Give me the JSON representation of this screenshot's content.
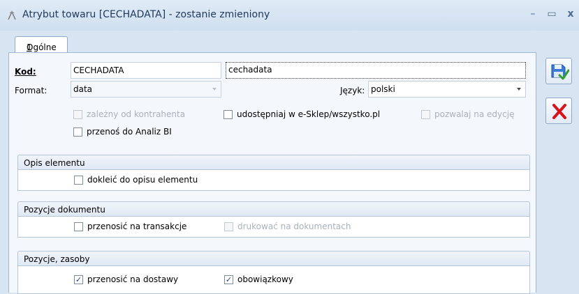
{
  "window": {
    "title": "Atrybut towaru [CECHADATA] - zostanie zmieniony",
    "min_glyph": "–",
    "max_glyph": "▭",
    "close_glyph": "x"
  },
  "tab": {
    "number": "1",
    "label": "Ogólne"
  },
  "form": {
    "kod_label": "Kod:",
    "kod_value": "CECHADATA",
    "nazwa_value": "cechadata",
    "format_label": "Format:",
    "format_value": "data",
    "jezyk_label": "Język:",
    "jezyk_value": "polski"
  },
  "checkboxes": {
    "zalezny": {
      "label": "zależny od kontrahenta",
      "checked": false,
      "disabled": true
    },
    "udostepniaj": {
      "label": "udostępniaj w e-Sklep/wszystko.pl",
      "checked": false,
      "disabled": false
    },
    "pozwalaj": {
      "label": "pozwalaj na edycję",
      "checked": false,
      "disabled": true
    },
    "przenos_bi": {
      "label": "przenoś do Analiz BI",
      "checked": false,
      "disabled": false
    }
  },
  "groups": {
    "opis": {
      "title": "Opis elementu",
      "dokleic": {
        "label": "dokleić do opisu elementu",
        "checked": false
      }
    },
    "pozycje_dok": {
      "title": "Pozycje dokumentu",
      "transakcje": {
        "label": "przenosić na transakcje",
        "checked": false
      },
      "drukowac": {
        "label": "drukować na dokumentach",
        "checked": false,
        "disabled": true
      }
    },
    "pozycje_zasoby": {
      "title": "Pozycje, zasoby",
      "dostawy": {
        "label": "przenosić na dostawy",
        "checked": true
      },
      "obowiazkowy": {
        "label": "obowiązkowy",
        "checked": true
      }
    }
  },
  "check_glyph": "✓",
  "colors": {
    "save_accent": "#2e6fd0",
    "cancel_accent": "#d8121a"
  }
}
